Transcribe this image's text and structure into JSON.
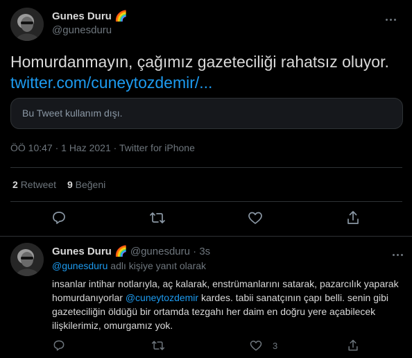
{
  "tweet": {
    "author": {
      "name": "Gunes Duru 🌈",
      "handle": "@gunesduru"
    },
    "text": "Homurdanmayın, çağımız gazeteciliği rahatsız oluyor.",
    "link": "twitter.com/cuneytozdemir/...",
    "card_text": "Bu Tweet kullanım dışı.",
    "meta": "ÖÖ 10:47 · 1 Haz 2021 · Twitter for iPhone",
    "stats": {
      "retweets_count": "2",
      "retweets_label": "Retweet",
      "likes_count": "9",
      "likes_label": "Beğeni"
    },
    "actions": {
      "reply_icon": "reply-icon",
      "retweet_icon": "retweet-icon",
      "like_icon": "heart-icon",
      "share_icon": "share-icon"
    }
  },
  "reply": {
    "author": {
      "name": "Gunes Duru 🌈",
      "handle": "@gunesduru",
      "time": "3s"
    },
    "separator": "·",
    "reply_to_mention": "@gunesduru",
    "reply_to_suffix": " adlı kişiye yanıt olarak",
    "text_part1": "insanlar intihar notlarıyla, aç kalarak, enstrümanlarını satarak, pazarcılık yaparak homurdanıyorlar ",
    "text_mention": "@cuneytozdemir",
    "text_part2": " kardes. tabii sanatçının çapı belli. senin gibi gazeteciliğin öldüğü bir ortamda tezgahı her daim en doğru yere açabilecek ilişkilerimiz, omurgamız yok.",
    "like_count": "3"
  },
  "colors": {
    "background": "#000000",
    "text": "#d9d9d9",
    "secondary": "#6e767d",
    "accent": "#1d9bf0",
    "border": "#2f3336"
  }
}
